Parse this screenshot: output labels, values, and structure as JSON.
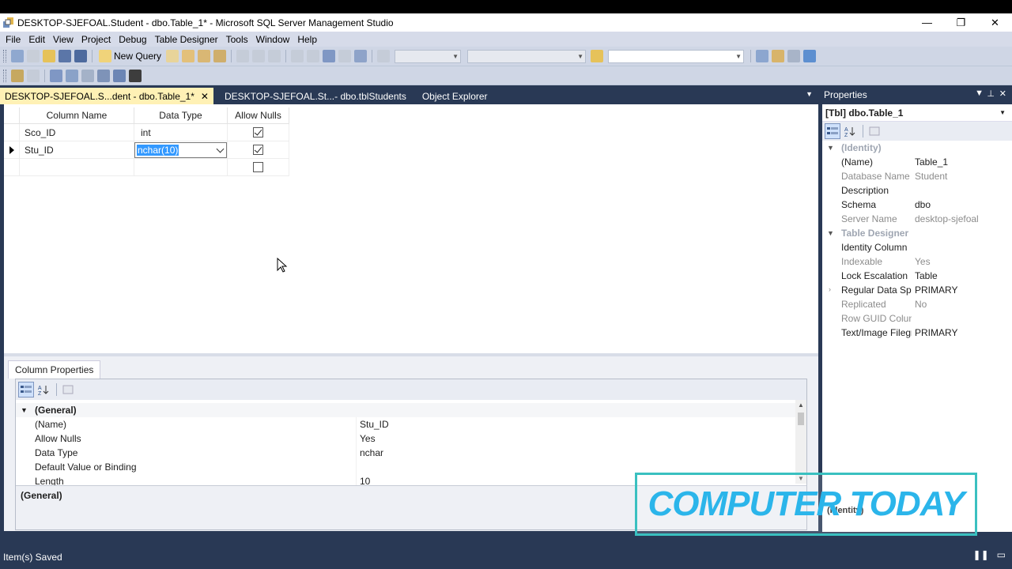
{
  "window": {
    "title": "DESKTOP-SJEFOAL.Student - dbo.Table_1* - Microsoft SQL Server Management Studio",
    "controls": [
      "—",
      "❐",
      "✕"
    ]
  },
  "menu": [
    "File",
    "Edit",
    "View",
    "Project",
    "Debug",
    "Table Designer",
    "Tools",
    "Window",
    "Help"
  ],
  "toolbar": {
    "new_query_label": "New Query"
  },
  "tabs": [
    {
      "label": "DESKTOP-SJEFOAL.S...dent - dbo.Table_1*",
      "active": true,
      "close": "✕"
    },
    {
      "label": "DESKTOP-SJEFOAL.St...- dbo.tblStudents",
      "active": false
    },
    {
      "label": "Object Explorer",
      "active": false
    }
  ],
  "designer": {
    "headers": {
      "name": "Column Name",
      "type": "Data Type",
      "nulls": "Allow Nulls"
    },
    "rows": [
      {
        "name": "Sco_ID",
        "type": "int",
        "allow_nulls": true
      },
      {
        "name": "Stu_ID",
        "type": "nchar(10)",
        "allow_nulls": true,
        "editing": true
      },
      {
        "name": "",
        "type": "",
        "allow_nulls": false
      }
    ]
  },
  "column_properties": {
    "tab_label": "Column Properties",
    "category": "(General)",
    "rows": [
      {
        "name": "(Name)",
        "value": "Stu_ID"
      },
      {
        "name": "Allow Nulls",
        "value": "Yes"
      },
      {
        "name": "Data Type",
        "value": "nchar"
      },
      {
        "name": "Default Value or Binding",
        "value": ""
      },
      {
        "name": "Length",
        "value": "10"
      }
    ],
    "description_title": "(General)"
  },
  "properties": {
    "title": "Properties",
    "object": "[Tbl] dbo.Table_1",
    "categories": [
      {
        "label": "(Identity)",
        "rows": [
          {
            "name": "(Name)",
            "value": "Table_1",
            "ro": false
          },
          {
            "name": "Database Name",
            "value": "Student",
            "ro": true
          },
          {
            "name": "Description",
            "value": "",
            "ro": false
          },
          {
            "name": "Schema",
            "value": "dbo",
            "ro": false
          },
          {
            "name": "Server Name",
            "value": "desktop-sjefoal",
            "ro": true
          }
        ]
      },
      {
        "label": "Table Designer",
        "rows": [
          {
            "name": "Identity Column",
            "value": "",
            "ro": false
          },
          {
            "name": "Indexable",
            "value": "Yes",
            "ro": true
          },
          {
            "name": "Lock Escalation",
            "value": "Table",
            "ro": false
          },
          {
            "name": "Regular Data Spac",
            "value": "PRIMARY",
            "ro": false,
            "expandable": true
          },
          {
            "name": "Replicated",
            "value": "No",
            "ro": true
          },
          {
            "name": "Row GUID Colum",
            "value": "",
            "ro": true
          },
          {
            "name": "Text/Image Filegro",
            "value": "PRIMARY",
            "ro": false
          }
        ]
      }
    ],
    "description_fragment": "(Identity)"
  },
  "status": {
    "text": "Item(s) Saved"
  },
  "watermark": {
    "text": "COMPUTER TODAY"
  },
  "colors": {
    "chrome": "#293955",
    "active_tab": "#fff1b5",
    "selection": "#3399ff",
    "watermark": "#2bb5ea"
  }
}
